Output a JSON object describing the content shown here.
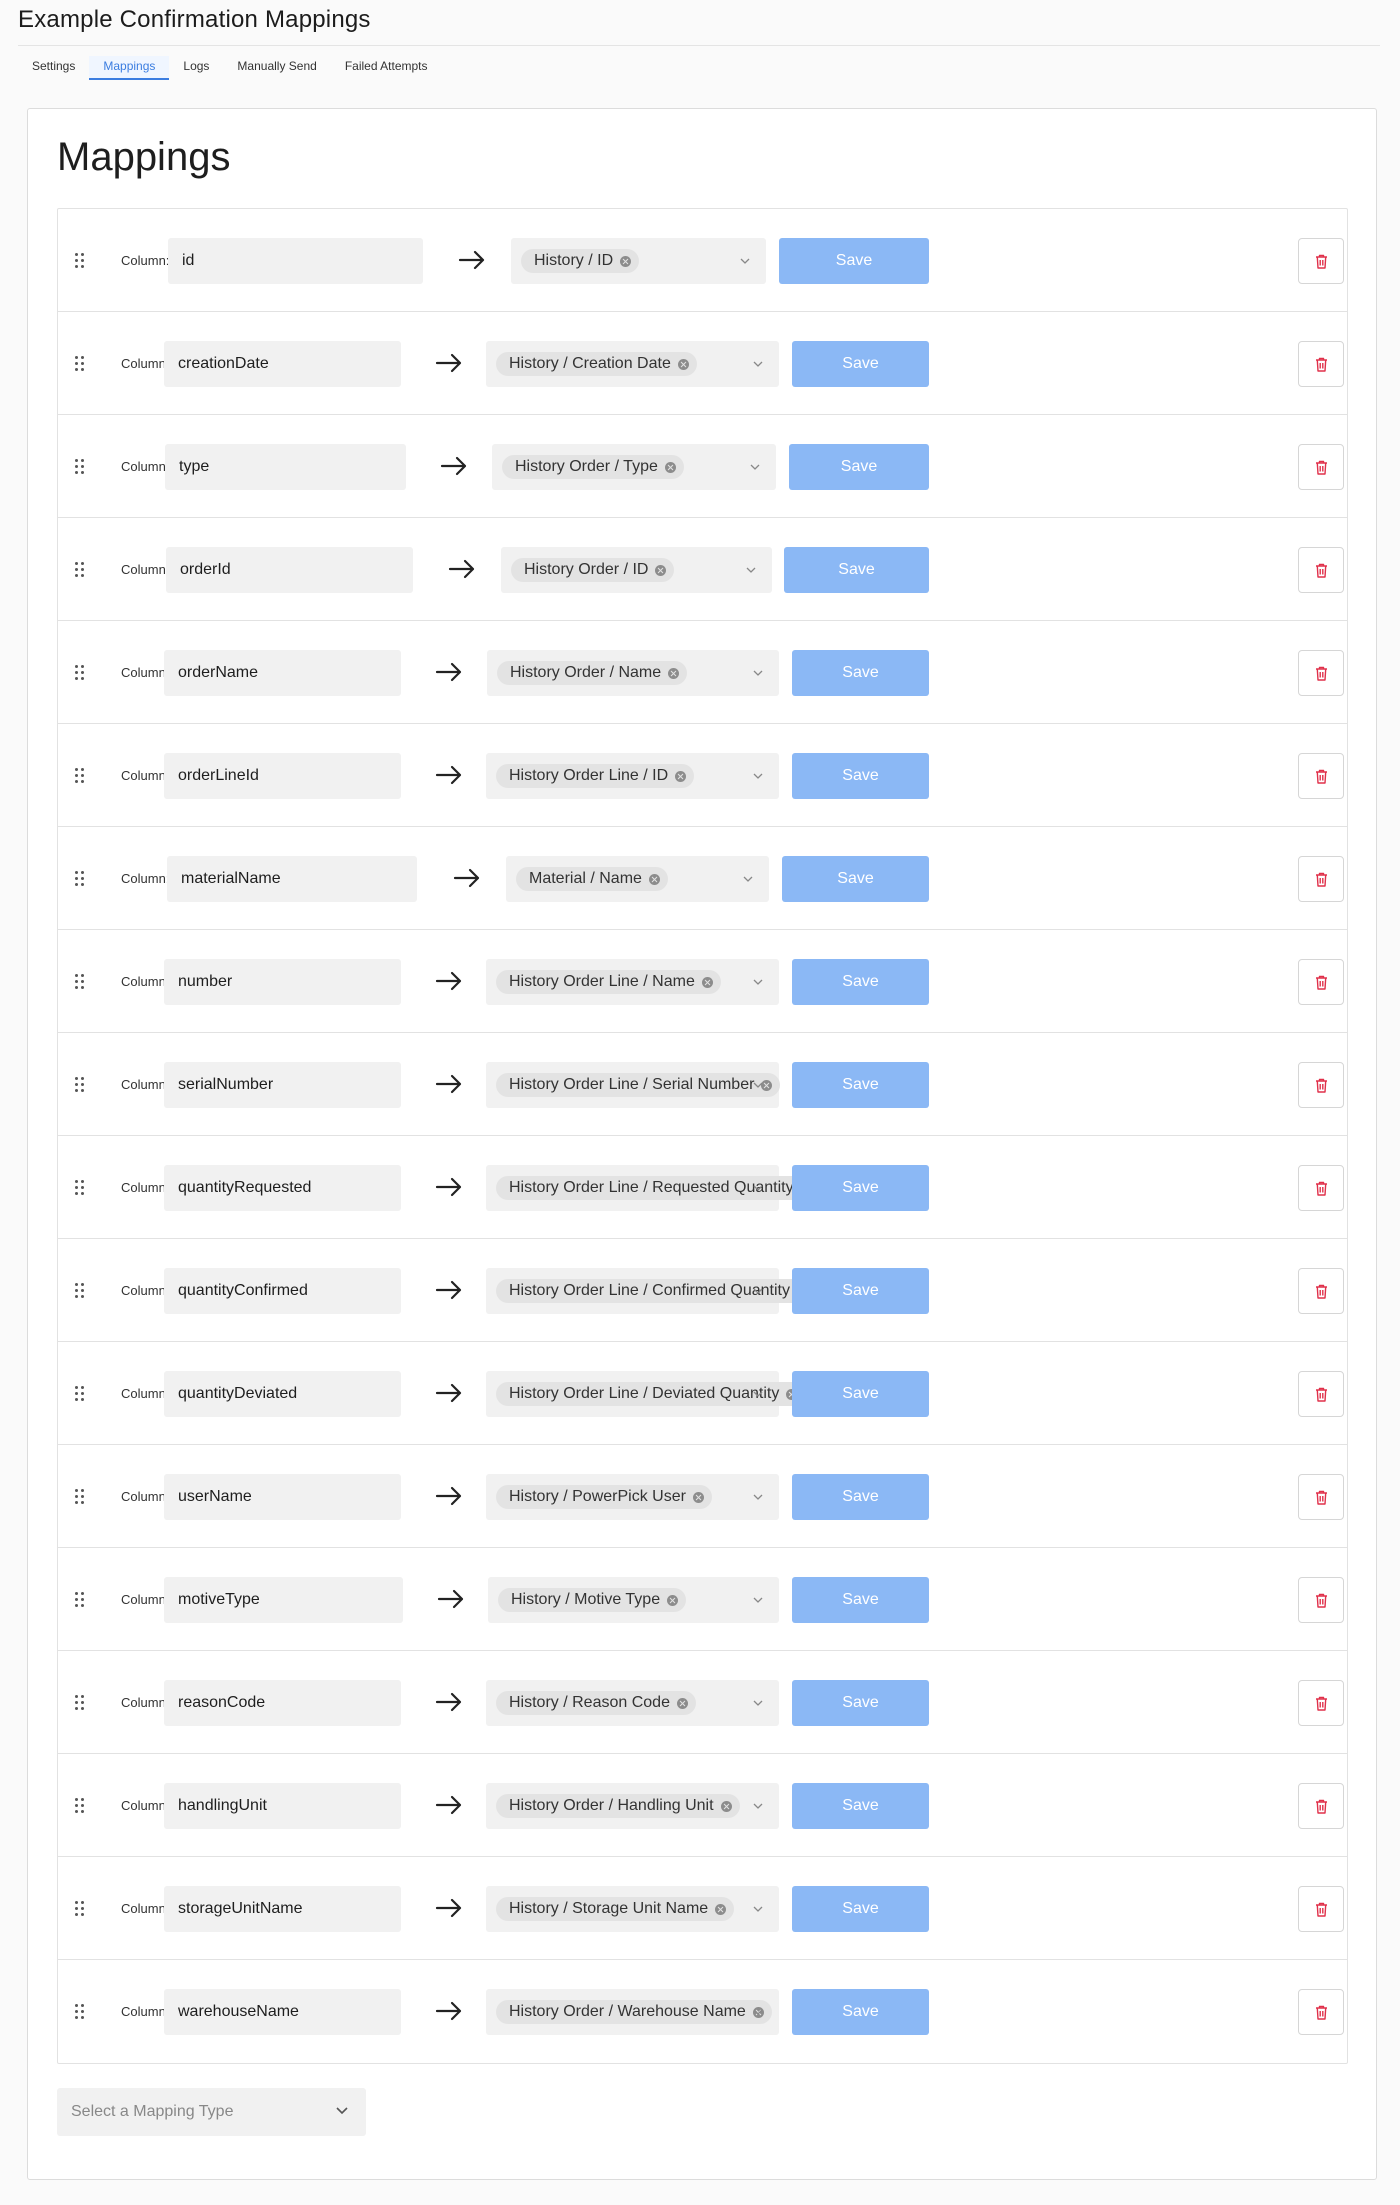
{
  "app": {
    "title": "Example Confirmation Mappings"
  },
  "tabs": [
    {
      "label": "Settings"
    },
    {
      "label": "Mappings",
      "active": true
    },
    {
      "label": "Logs"
    },
    {
      "label": "Manually Send"
    },
    {
      "label": "Failed Attempts"
    }
  ],
  "page": {
    "heading": "Mappings"
  },
  "column_label": "Column:",
  "save_label": "Save",
  "mappings": [
    {
      "column": "id",
      "mapping": "History / ID"
    },
    {
      "column": "creationDate",
      "mapping": "History / Creation Date"
    },
    {
      "column": "type",
      "mapping": "History Order / Type"
    },
    {
      "column": "orderId",
      "mapping": "History Order / ID"
    },
    {
      "column": "orderName",
      "mapping": "History Order / Name"
    },
    {
      "column": "orderLineId",
      "mapping": "History Order Line / ID"
    },
    {
      "column": "materialName",
      "mapping": "Material / Name"
    },
    {
      "column": "number",
      "mapping": "History Order Line / Name"
    },
    {
      "column": "serialNumber",
      "mapping": "History Order Line / Serial Number"
    },
    {
      "column": "quantityRequested",
      "mapping": "History Order Line / Requested Quantity"
    },
    {
      "column": "quantityConfirmed",
      "mapping": "History Order Line / Confirmed Quantity"
    },
    {
      "column": "quantityDeviated",
      "mapping": "History Order Line / Deviated Quantity"
    },
    {
      "column": "userName",
      "mapping": "History / PowerPick User"
    },
    {
      "column": "motiveType",
      "mapping": "History / Motive Type"
    },
    {
      "column": "reasonCode",
      "mapping": "History / Reason Code"
    },
    {
      "column": "handlingUnit",
      "mapping": "History Order / Handling Unit"
    },
    {
      "column": "storageUnitName",
      "mapping": "History / Storage Unit Name"
    },
    {
      "column": "warehouseName",
      "mapping": "History Order / Warehouse Name"
    }
  ],
  "mapping_type_select": {
    "placeholder": "Select a Mapping Type"
  },
  "icons": {
    "drag": "drag-handle-icon",
    "arrow": "arrow-right-icon",
    "remove_chip": "close-circle-icon",
    "dropdown": "chevron-down-icon",
    "delete": "trash-icon"
  },
  "colors": {
    "accent": "#3b7de0",
    "save_button": "#8bb8f5",
    "delete_icon": "#e0304a",
    "field_bg": "#f1f1f1"
  }
}
